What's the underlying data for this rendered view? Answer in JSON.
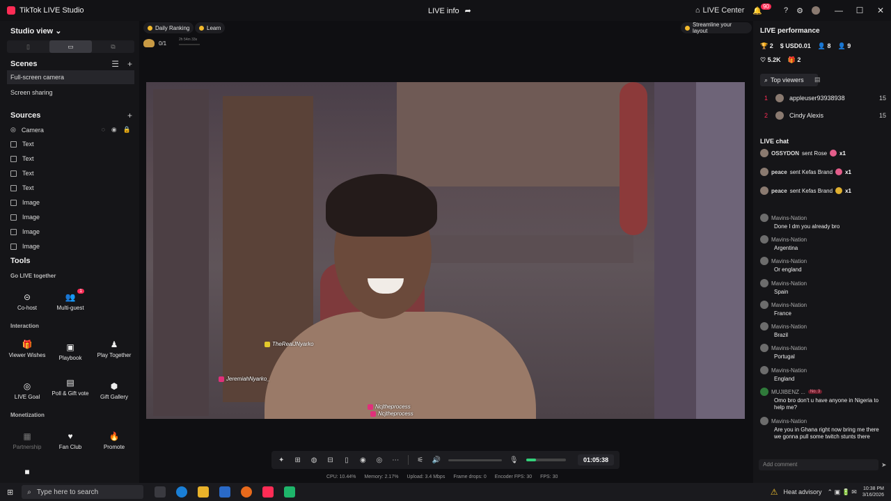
{
  "titlebar": {
    "app_title": "TikTok LIVE Studio",
    "center_title": "LIVE info",
    "live_center": "LIVE Center",
    "notif_count": "90"
  },
  "left": {
    "view_label": "Studio view",
    "scenes_title": "Scenes",
    "scenes": [
      "Full-screen camera",
      "Screen sharing"
    ],
    "sources_title": "Sources",
    "sources": [
      "Camera",
      "Text",
      "Text",
      "Text",
      "Text",
      "Image",
      "Image",
      "Image",
      "Image"
    ],
    "tools_title": "Tools",
    "go_live_together": "Go LIVE together",
    "cohost": "Co-host",
    "multiguest": "Multi-guest",
    "multiguest_badge": "1",
    "interaction": "Interaction",
    "viewer_wishes": "Viewer Wishes",
    "playbook": "Playbook",
    "play_together": "Play Together",
    "live_goal": "LIVE Goal",
    "poll_gift_vote": "Poll & Gift vote",
    "gift_gallery": "Gift Gallery",
    "monetization": "Monetization",
    "partnership": "Partnership",
    "fan_club": "Fan Club",
    "promote": "Promote"
  },
  "center": {
    "daily_ranking": "Daily Ranking",
    "learn": "Learn",
    "goal_value": "0/1",
    "goal_time": "2h 54m 33s",
    "streamline": "Streamline your layout",
    "tags": {
      "real": "TheRealJNyarko",
      "jeremiah": "JeremiahNyarko_",
      "ncj1": "Ncjtheprocess",
      "ncj2": "Ncjtheprocess"
    },
    "timer": "01:05:38",
    "stats": {
      "cpu": "CPU: 10.44%",
      "memory": "Memory: 2.17%",
      "upload": "Upload: 3.4 Mbps",
      "frame_drops": "Frame drops: 0",
      "encoder_fps": "Encoder FPS: 30",
      "fps": "FPS: 30"
    }
  },
  "right": {
    "title": "LIVE performance",
    "m1": "2",
    "m2": "USD0.01",
    "m3": "8",
    "m4": "9",
    "m5": "5.2K",
    "m6": "2",
    "top_viewers_label": "Top viewers",
    "top_viewers": [
      {
        "rank": "1",
        "name": "appleuser93938938",
        "score": "15"
      },
      {
        "rank": "2",
        "name": "Cindy Alexis",
        "score": "15"
      }
    ],
    "chat_title": "LIVE chat",
    "gifts": [
      {
        "user": "OSSYDON",
        "action": "sent Rose",
        "count": "x1"
      },
      {
        "user": "peace",
        "action": "sent Kefas Brand",
        "count": "x1"
      },
      {
        "user": "peace",
        "action": "sent Kefas Brand",
        "count": "x1"
      }
    ],
    "messages": [
      {
        "user": "Mavins-Nation",
        "text": "Done I dm you already bro"
      },
      {
        "user": "Mavins-Nation",
        "text": "Argentina"
      },
      {
        "user": "Mavins-Nation",
        "text": "Or england"
      },
      {
        "user": "Mavins-Nation",
        "text": "Spain"
      },
      {
        "user": "Mavins-Nation",
        "text": "France"
      },
      {
        "user": "Mavins-Nation",
        "text": "Brazil"
      },
      {
        "user": "Mavins-Nation",
        "text": "Portugal"
      },
      {
        "user": "Mavins-Nation",
        "text": "England"
      },
      {
        "user": "MUJIBENZ ...",
        "text": "Omo bro don't u have anyone in Nigeria to help me?"
      },
      {
        "user": "Mavins-Nation",
        "text": "Are you in Ghana right now bring me there we gonna pull some twitch stunts there"
      }
    ],
    "rank_chip": "No. 3",
    "add_comment": "Add comment"
  },
  "taskbar": {
    "search_placeholder": "Type here to search",
    "heat": "Heat advisory",
    "time": "10:38 PM",
    "date": "3/16/2026"
  }
}
